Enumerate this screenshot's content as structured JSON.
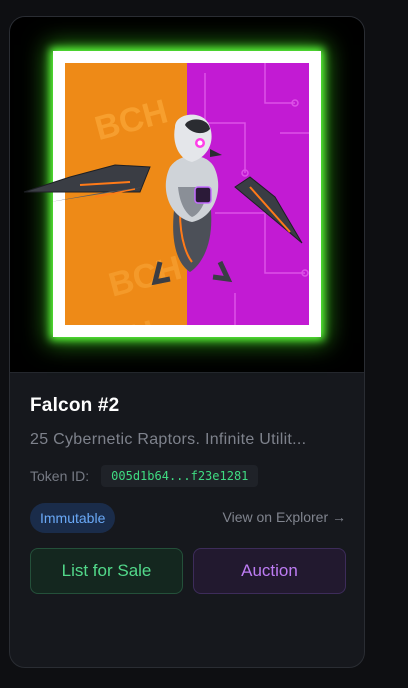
{
  "nft": {
    "image_label": "BCH",
    "title": "Falcon #2",
    "description": "25 Cybernetic Raptors. Infinite Utilit...",
    "token_label": "Token ID:",
    "token_id": "005d1b64...f23e1281",
    "badge": "Immutable",
    "explorer_link": "View on Explorer →"
  },
  "actions": {
    "list_label": "List for Sale",
    "auction_label": "Auction"
  },
  "colors": {
    "glow": "#5dff3c",
    "left_panel": "#f08a16",
    "right_panel": "#c616d8",
    "token_text": "#3fdc82",
    "sale_text": "#52d98a",
    "auction_text": "#bd7cf3",
    "badge_text": "#6aa9f7"
  }
}
